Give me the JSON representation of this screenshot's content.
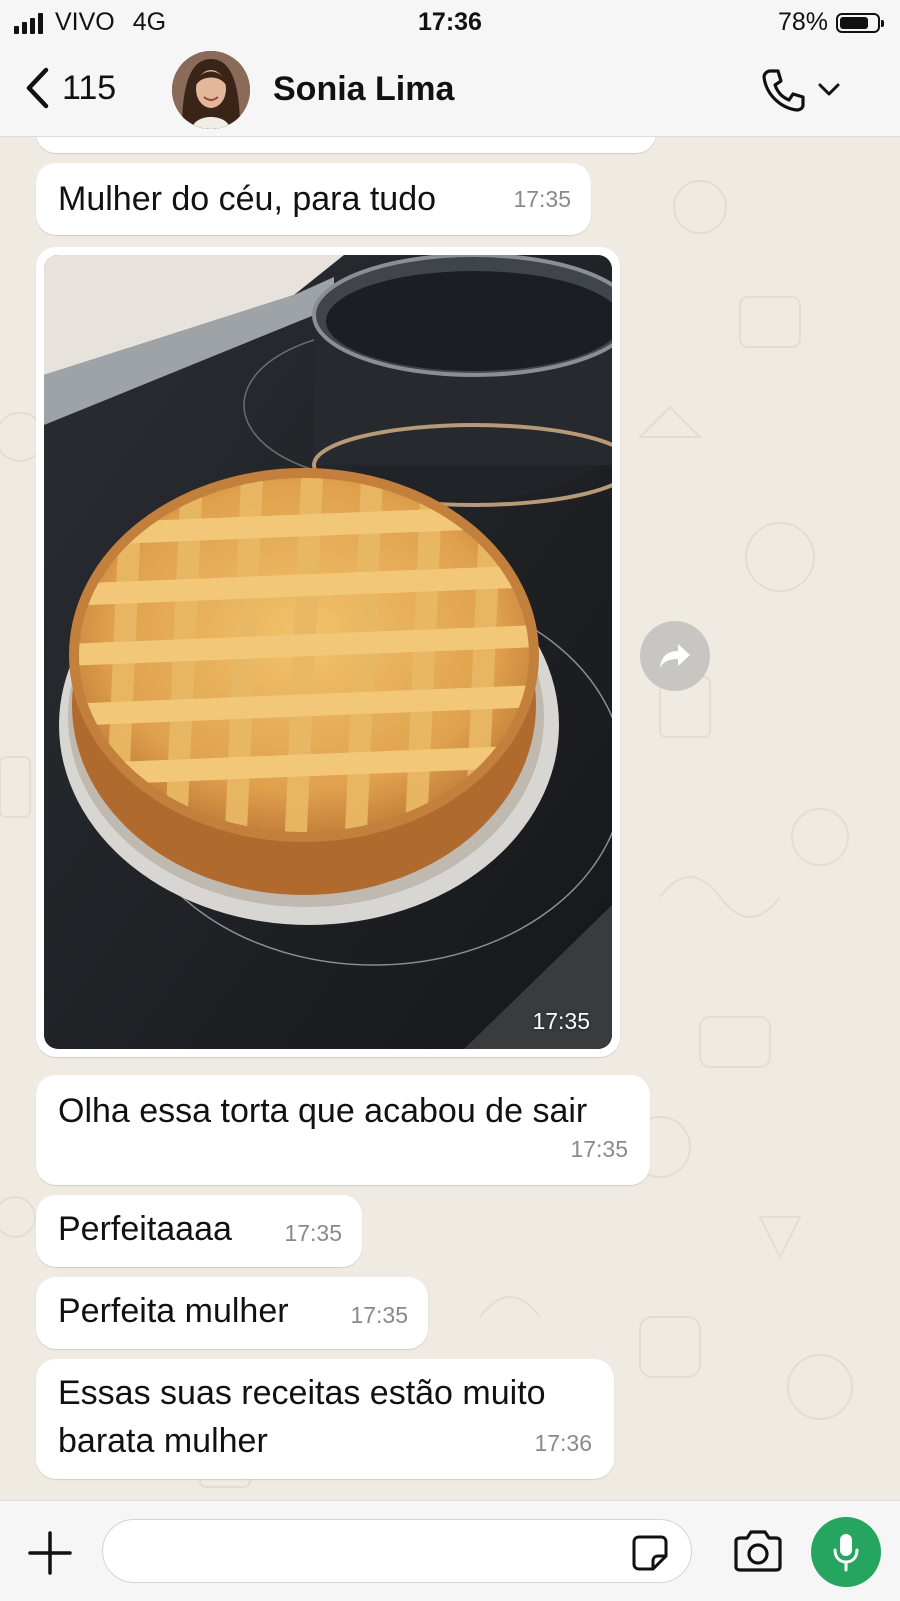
{
  "status_bar": {
    "carrier": "VIVO",
    "network": "4G",
    "time": "17:36",
    "battery": "78%",
    "battery_level": 0.78
  },
  "header": {
    "back_count": "115",
    "contact_name": "Sonia Lima",
    "call_icon": "phone-icon",
    "call_menu_icon": "chevron-down-icon"
  },
  "messages": [
    {
      "text": "Mulher do céu, para tudo",
      "time": "17:35"
    },
    {
      "type": "image",
      "description_icon": "photo-pie",
      "time": "17:35"
    },
    {
      "text": "Olha essa torta que acabou de sair",
      "time": "17:35"
    },
    {
      "text": "Perfeitaaaa",
      "time": "17:35"
    },
    {
      "text": "Perfeita mulher",
      "time": "17:35"
    },
    {
      "text_line1": "Essas suas receitas estão muito",
      "text_line2": "barata mulher",
      "time": "17:36"
    }
  ],
  "input": {
    "placeholder": ""
  },
  "colors": {
    "background": "#efeae2",
    "bubble": "#ffffff",
    "mic_button": "#25a55f",
    "timestamp": "#8a8a8a"
  }
}
